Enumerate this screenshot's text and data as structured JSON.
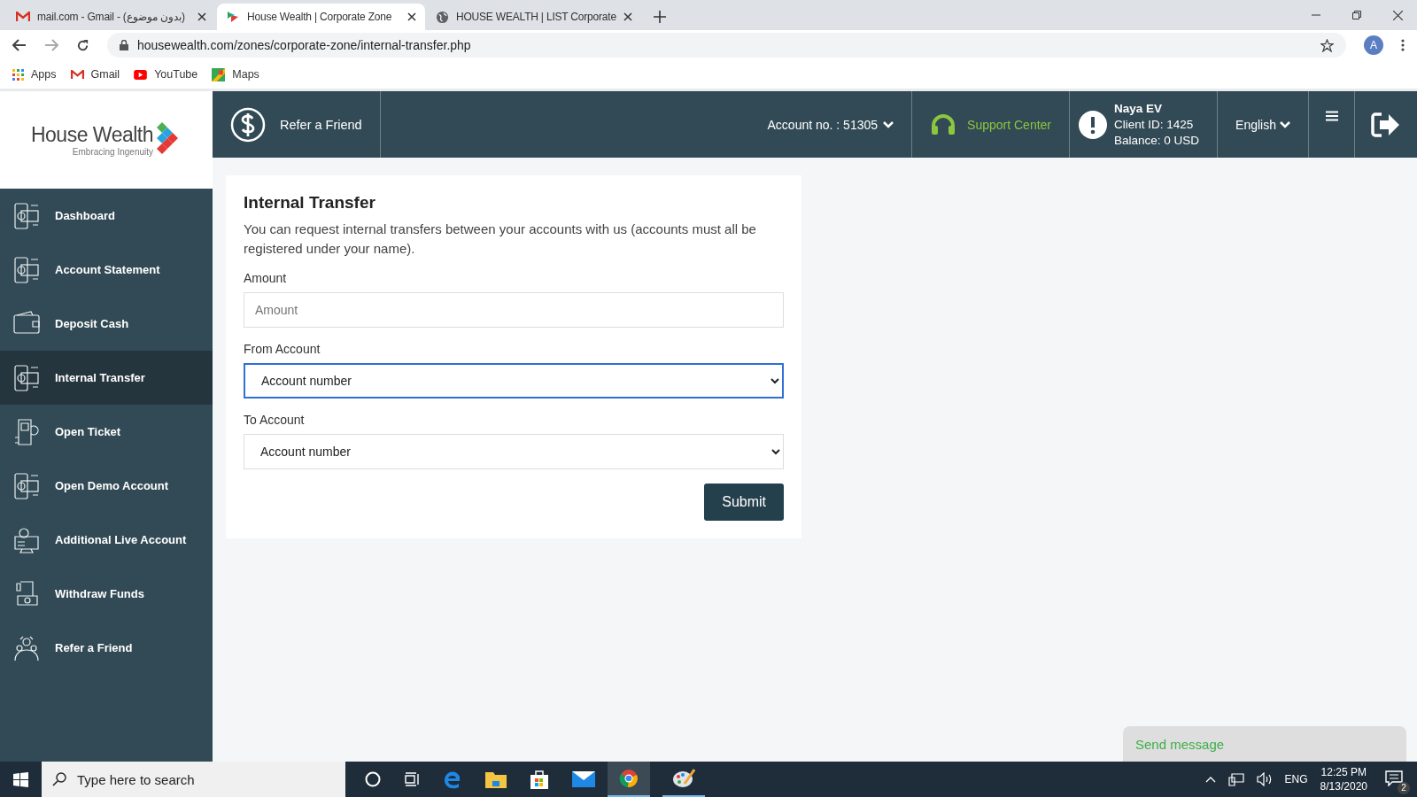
{
  "browser": {
    "tabs": [
      {
        "title": "mail.com - Gmail - (بدون موضوع)",
        "selected": false,
        "kind": "mail"
      },
      {
        "title": "House Wealth | Corporate Zone",
        "selected": true,
        "kind": "logo"
      },
      {
        "title": "HOUSE WEALTH | LIST Corporate",
        "selected": false,
        "kind": "globe"
      }
    ],
    "url": "housewealth.com/zones/corporate-zone/internal-transfer.php",
    "avatar": "A",
    "bookmarks": [
      {
        "label": "Apps",
        "kind": "apps"
      },
      {
        "label": "Gmail",
        "kind": "mail"
      },
      {
        "label": "YouTube",
        "kind": "youtube"
      },
      {
        "label": "Maps",
        "kind": "maps"
      }
    ]
  },
  "logo": {
    "name": "House Wealth",
    "tagline": "Embracing Ingenuity"
  },
  "header": {
    "refer": "Refer a Friend",
    "account": "Account no. : 51305",
    "support": "Support Center",
    "user": "Naya EV",
    "client_id": "Client ID: 1425",
    "balance": "Balance: 0 USD",
    "language": "English"
  },
  "sidebar": {
    "items": [
      {
        "label": "Dashboard",
        "selected": false
      },
      {
        "label": "Account Statement",
        "selected": false
      },
      {
        "label": "Deposit Cash",
        "selected": false
      },
      {
        "label": "Internal Transfer",
        "selected": true
      },
      {
        "label": "Open Ticket",
        "selected": false
      },
      {
        "label": "Open Demo Account",
        "selected": false
      },
      {
        "label": "Additional Live Account",
        "selected": false
      },
      {
        "label": "Withdraw Funds",
        "selected": false
      },
      {
        "label": "Refer a Friend",
        "selected": false
      }
    ]
  },
  "form": {
    "title": "Internal Transfer",
    "description": "You can request internal transfers between your accounts with us (accounts must all be registered under your name).",
    "amount": {
      "label": "Amount",
      "placeholder": "Amount"
    },
    "from": {
      "label": "From Account",
      "value": "Account number",
      "focused": true
    },
    "to": {
      "label": "To Account",
      "value": "Account number",
      "focused": false
    },
    "submit": "Submit"
  },
  "chat": {
    "placeholder": "Send message"
  },
  "taskbar": {
    "search": "Type here to search",
    "language": "ENG",
    "time": "12:25 PM",
    "date": "8/13/2020",
    "notifications": "2"
  }
}
